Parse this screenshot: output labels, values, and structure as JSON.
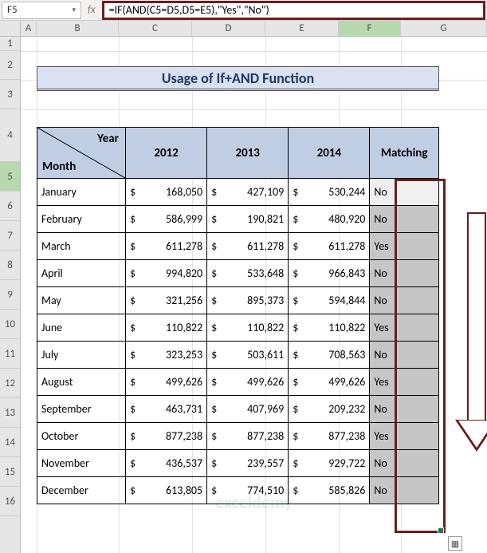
{
  "nameBox": "F5",
  "fxSymbol": "fx",
  "formula": "=IF(AND(C5=D5,D5=E5),\"Yes\",\"No\")",
  "title": "Usage of If+AND Function",
  "cornerLabels": {
    "year": "Year",
    "month": "Month"
  },
  "columns": {
    "c1": "2012",
    "c2": "2013",
    "c3": "2014",
    "c4": "Matching"
  },
  "colLetters": [
    "A",
    "B",
    "C",
    "D",
    "E",
    "F",
    "G"
  ],
  "rowNumbers": [
    "1",
    "2",
    "3",
    "4",
    "5",
    "6",
    "7",
    "8",
    "9",
    "10",
    "11",
    "12",
    "13",
    "14",
    "15",
    "16"
  ],
  "rows": [
    {
      "month": "January",
      "v1": "168,050",
      "v2": "427,109",
      "v3": "530,244",
      "match": "No"
    },
    {
      "month": "February",
      "v1": "586,999",
      "v2": "190,821",
      "v3": "480,920",
      "match": "No"
    },
    {
      "month": "March",
      "v1": "611,278",
      "v2": "611,278",
      "v3": "611,278",
      "match": "Yes"
    },
    {
      "month": "April",
      "v1": "994,820",
      "v2": "533,648",
      "v3": "966,843",
      "match": "No"
    },
    {
      "month": "May",
      "v1": "321,256",
      "v2": "895,373",
      "v3": "594,844",
      "match": "No"
    },
    {
      "month": "June",
      "v1": "110,822",
      "v2": "110,822",
      "v3": "110,822",
      "match": "Yes"
    },
    {
      "month": "July",
      "v1": "323,253",
      "v2": "503,611",
      "v3": "708,563",
      "match": "No"
    },
    {
      "month": "August",
      "v1": "499,626",
      "v2": "499,626",
      "v3": "499,626",
      "match": "Yes"
    },
    {
      "month": "September",
      "v1": "463,731",
      "v2": "407,969",
      "v3": "209,232",
      "match": "No"
    },
    {
      "month": "October",
      "v1": "877,238",
      "v2": "877,238",
      "v3": "877,238",
      "match": "Yes"
    },
    {
      "month": "November",
      "v1": "436,537",
      "v2": "239,557",
      "v3": "929,722",
      "match": "No"
    },
    {
      "month": "December",
      "v1": "613,805",
      "v2": "774,510",
      "v3": "585,826",
      "match": "No"
    }
  ],
  "watermark": "exceldemy",
  "currency": "$"
}
